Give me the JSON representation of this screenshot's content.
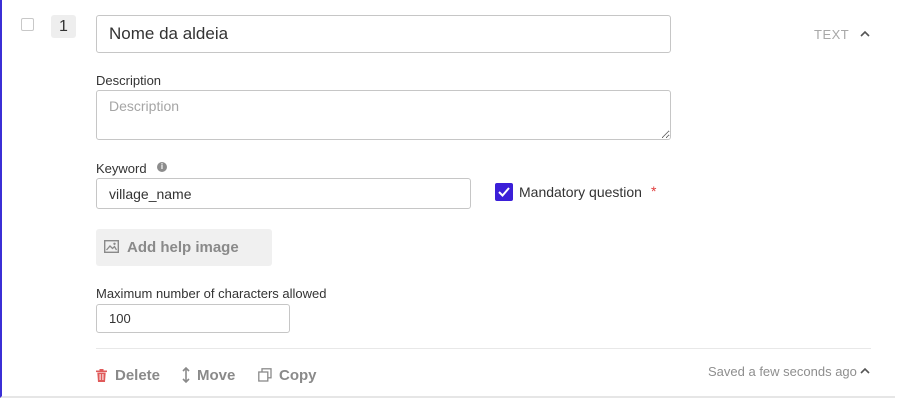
{
  "question": {
    "number": "1",
    "title_value": "Nome da aldeia",
    "type": "TEXT"
  },
  "description": {
    "label": "Description",
    "placeholder": "Description",
    "value": ""
  },
  "keyword": {
    "label": "Keyword",
    "value": "village_name"
  },
  "mandatory": {
    "label": "Mandatory question",
    "asterisk": "*",
    "checked": true
  },
  "help_image": {
    "label": "Add help image"
  },
  "max_chars": {
    "label": "Maximum number of characters allowed",
    "value": "100"
  },
  "footer": {
    "delete_label": "Delete",
    "move_label": "Move",
    "copy_label": "Copy",
    "saved_status": "Saved a few seconds ago"
  },
  "colors": {
    "accent": "#3b1fd8",
    "delete_icon": "#e05a5a",
    "required": "#e03a3a"
  }
}
